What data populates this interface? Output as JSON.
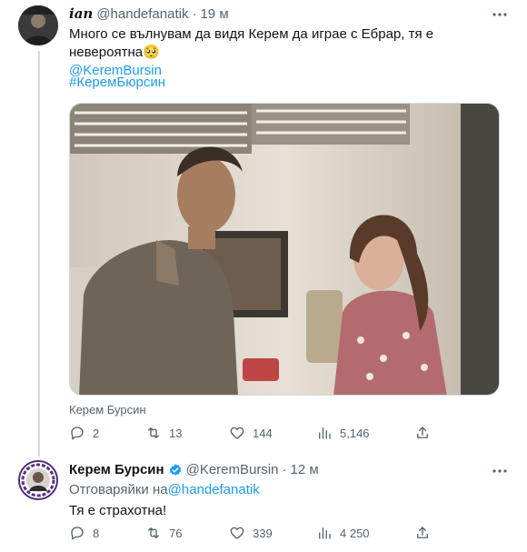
{
  "tweet1": {
    "display_name": "ian",
    "handle": "@handefanatik",
    "separator": "·",
    "time": "19 м",
    "text": "Много се вълнувам да видя Керем да играе с Ебрар, тя е невероятна🥺",
    "mention": "@KeremBursin",
    "hashtag": "#КеремБюрсин",
    "media_caption": "Керем Бурсин",
    "stats": {
      "replies": "2",
      "retweets": "13",
      "likes": "144",
      "views": "5,146"
    }
  },
  "tweet2": {
    "display_name": "Керем Бурсин",
    "handle": "@KeremBursin",
    "separator": "·",
    "time": "12 м",
    "reply_prefix": "Отговаряйки на",
    "reply_handle": "@handefanatik",
    "text": "Тя е страхотна!",
    "stats": {
      "replies": "8",
      "retweets": "76",
      "likes": "339",
      "views": "4 250"
    }
  },
  "colors": {
    "accent": "#1d9bf0",
    "secondary_text": "#536471",
    "thread_line": "#cfd9de",
    "verified": "#1d9bf0"
  },
  "icons": [
    "reply-icon",
    "retweet-icon",
    "like-icon",
    "views-icon",
    "share-icon",
    "more-icon",
    "verified-badge-icon"
  ]
}
